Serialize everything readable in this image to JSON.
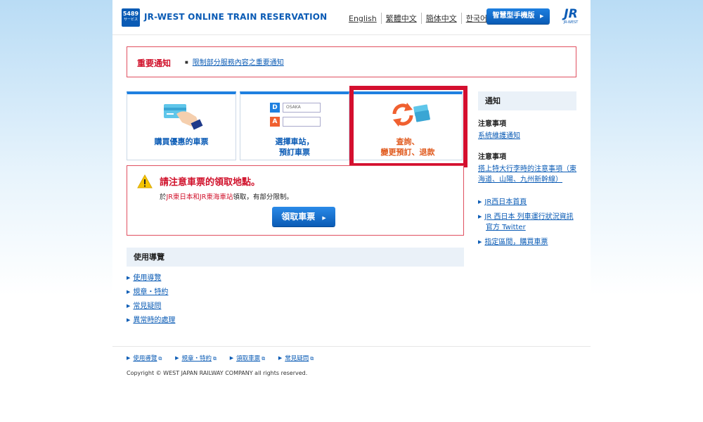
{
  "header": {
    "logo_number": "5489",
    "logo_sub": "サービス",
    "title": "JR-WEST ONLINE TRAIN RESERVATION",
    "languages": [
      "English",
      "繁體中文",
      "簡体中文",
      "한국어"
    ],
    "mobile_button": "智慧型手機版",
    "jr_logo": "JR",
    "jr_logo_sub": "JR-WEST"
  },
  "notice": {
    "title": "重要通知",
    "link": "限制部分服務內容之重要通知"
  },
  "cards": [
    {
      "line1": "購買優惠的車票",
      "line2": ""
    },
    {
      "line1": "選擇車站，",
      "line2": "預訂車票",
      "station_d": "D",
      "station_a": "A",
      "station_d_value": "OSAKA"
    },
    {
      "line1": "查詢、",
      "line2": "變更預訂、退款"
    }
  ],
  "warning": {
    "title": "請注意車票的領取地點。",
    "text_prefix": "於",
    "text_red": "JR東日本和JR東海車站",
    "text_suffix": "領取，有部分限制。",
    "button": "領取車票"
  },
  "guide": {
    "title": "使用導覽",
    "items": [
      "使用導覽",
      "規章・特約",
      "常見疑問",
      "異常時的處理"
    ]
  },
  "sidebar": {
    "title": "通知",
    "notices": [
      {
        "heading": "注意事項",
        "link": "系統維護通知"
      },
      {
        "heading": "注意事項",
        "link": "搭上特大行李時的注意事項（東海道、山陽、九州新幹線）"
      }
    ],
    "links": [
      "JR西日本首頁",
      "JR 西日本 列車運行狀況資訊 官方 Twitter",
      "指定區間，購買車票"
    ]
  },
  "footer": {
    "links": [
      "使用導覽",
      "規章・特約",
      "領取車票",
      "常見疑問"
    ],
    "copyright": "Copyright © WEST JAPAN RAILWAY COMPANY all rights reserved."
  },
  "colors": {
    "brand_blue": "#0a5bb5",
    "alert_red": "#d0102a",
    "highlight_red": "#d40f2f",
    "accent_orange": "#e05a1e"
  }
}
